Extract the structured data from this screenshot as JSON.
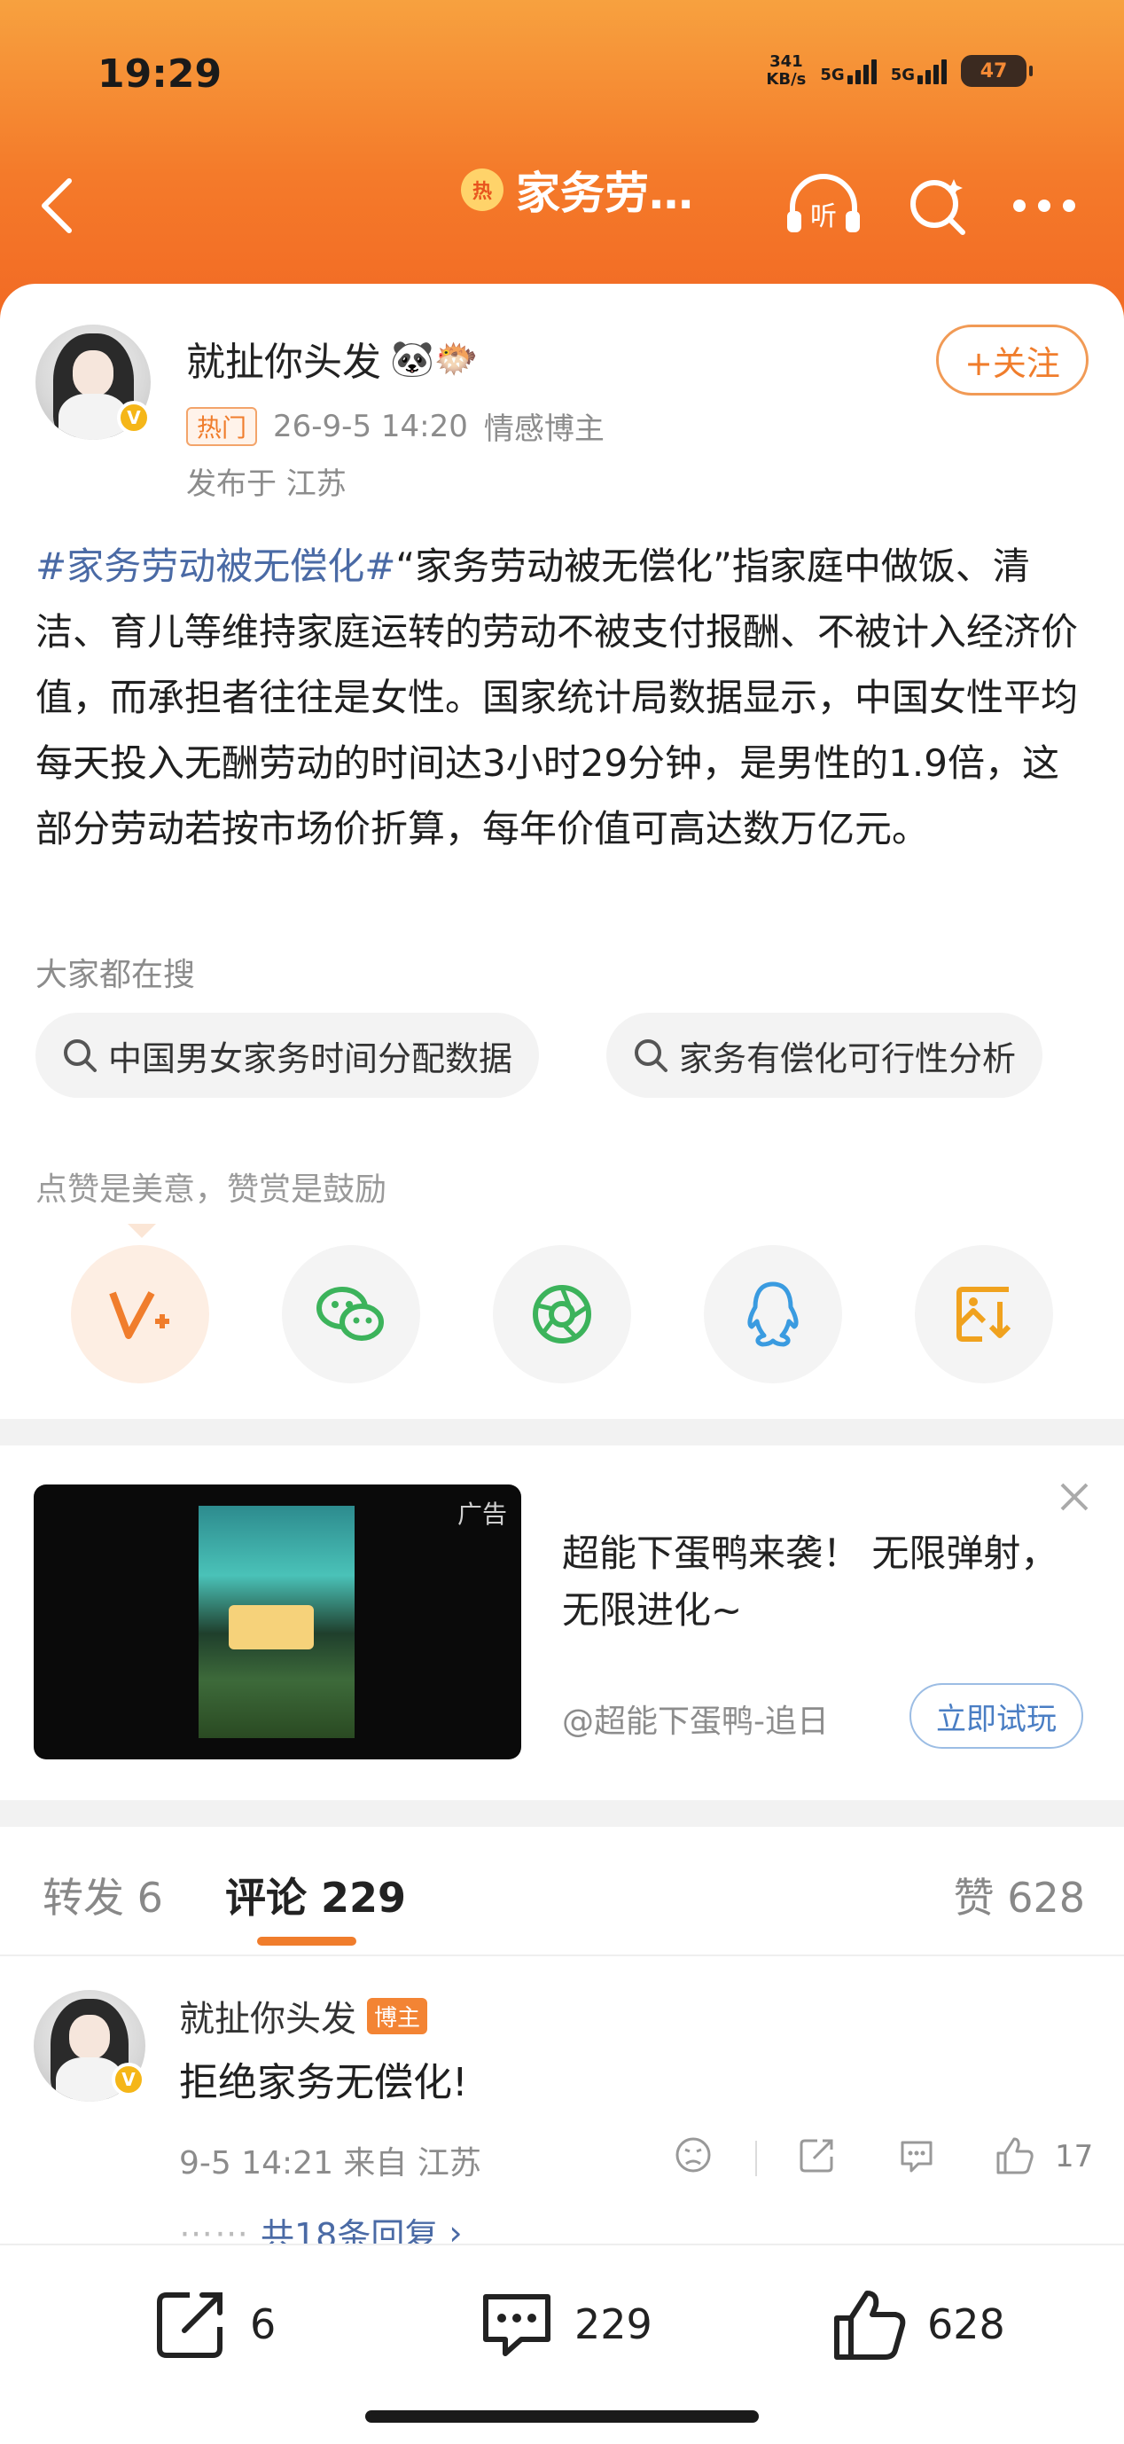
{
  "status_bar": {
    "time": "19:29",
    "net_speed_value": "341",
    "net_speed_unit": "KB/s",
    "signal1": "5G",
    "signal2": "5G",
    "battery": "47"
  },
  "nav": {
    "hot_badge": "热",
    "title": "家务劳…",
    "icons": [
      "back-icon",
      "listen-icon",
      "search-icon",
      "more-icon"
    ]
  },
  "post": {
    "author": "就扯你头发",
    "author_emojis": "🐼🐡",
    "follow_label": "+关注",
    "tag": "热门",
    "timestamp": "26-9-5 14:20",
    "category": "情感博主",
    "location": "发布于 江苏",
    "hashtag": "#家务劳动被无偿化#",
    "text": "“家务劳动被无偿化”指家庭中做饭、清洁、育儿等维持家庭运转的劳动不被支付报酬、不被计入经济价值，而承担者往往是女性。国家统计局数据显示，中国女性平均每天投入无酬劳动的时间达3小时29分钟，是男性的1.9倍，这部分劳动若按市场价折算，每年价值可高达数万亿元。"
  },
  "search_section": {
    "label": "大家都在搜",
    "chips": [
      "中国男女家务时间分配数据",
      "家务有偿化可行性分析"
    ]
  },
  "share_section": {
    "label": "点赞是美意，赞赏是鼓励",
    "buttons": [
      "reward-icon",
      "wechat-icon",
      "moments-icon",
      "qq-icon",
      "save-image-icon"
    ]
  },
  "ad": {
    "tag": "广告",
    "title": "超能下蛋鸭来袭！ 无限弹射，无限进化~",
    "advertiser": "@超能下蛋鸭-追日",
    "cta": "立即试玩"
  },
  "tabs": {
    "repost": "转发 6",
    "comments": "评论 229",
    "likes": "赞 628"
  },
  "comment": {
    "author": "就扯你头发",
    "badge": "博主",
    "text": "拒绝家务无偿化!",
    "meta": "9-5 14:21 来自 江苏",
    "like_count": "17",
    "replies": "共18条回复"
  },
  "bottom_bar": {
    "repost_count": "6",
    "comment_count": "229",
    "like_count": "628"
  },
  "colors": {
    "header_orange": "#f47a2a",
    "accent_orange": "#f07d2c",
    "link_blue": "#4a6aa5"
  }
}
